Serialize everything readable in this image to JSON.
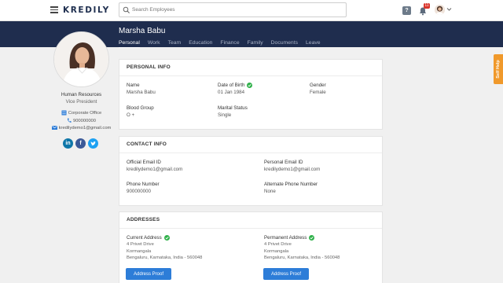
{
  "app": {
    "logo_text": "KREDILY",
    "search_placeholder": "Search Employees",
    "help_label": "?",
    "notification_count": "11"
  },
  "employee": {
    "name": "Marsha Babu",
    "department": "Human Resources",
    "designation": "Vice President",
    "office": "Corporate Office",
    "phone": "900000000",
    "email": "kredilydemo1@gmail.com"
  },
  "tabs": [
    {
      "label": "Personal",
      "active": true
    },
    {
      "label": "Work"
    },
    {
      "label": "Team"
    },
    {
      "label": "Education"
    },
    {
      "label": "Finance"
    },
    {
      "label": "Family"
    },
    {
      "label": "Documents"
    },
    {
      "label": "Leave"
    }
  ],
  "personal_info": {
    "title": "PERSONAL INFO",
    "name_label": "Name",
    "name_value": "Marsha Babu",
    "dob_label": "Date of Birth",
    "dob_value": "01 Jan 1984",
    "gender_label": "Gender",
    "gender_value": "Female",
    "blood_label": "Blood Group",
    "blood_value": "O +",
    "marital_label": "Marital Status",
    "marital_value": "Single"
  },
  "contact_info": {
    "title": "CONTACT INFO",
    "official_email_label": "Official Email ID",
    "official_email_value": "kredilydemo1@gmail.com",
    "personal_email_label": "Personal Email ID",
    "personal_email_value": "kredilydemo1@gmail.com",
    "phone_label": "Phone Number",
    "phone_value": "900000000",
    "alt_phone_label": "Alternate Phone Number",
    "alt_phone_value": "None"
  },
  "addresses": {
    "title": "ADDRESSES",
    "current_label": "Current Address",
    "current_line1": "4 Privet Drive",
    "current_line2": "Kormangala",
    "current_line3": "Bengaluru, Karnataka, India - 560048",
    "permanent_label": "Permanent Address",
    "permanent_line1": "4 Privet Drive",
    "permanent_line2": "Kormangala",
    "permanent_line3": "Bengaluru, Karnataka, India - 560048",
    "proof_button": "Address Proof"
  },
  "self_help": "Self Help",
  "colors": {
    "header_band": "#1f2d4e",
    "accent_blue": "#2d7dd8",
    "verified_green": "#2fb14a",
    "self_help_orange": "#f0992b",
    "linkedin": "#0e76a8",
    "facebook": "#3b5998",
    "twitter": "#1da1f2"
  },
  "icons": [
    "menu-icon",
    "search-icon",
    "bell-icon",
    "chevron-down-icon",
    "building-icon",
    "phone-icon",
    "mail-icon",
    "linkedin-icon",
    "facebook-icon",
    "twitter-icon",
    "check-icon"
  ]
}
